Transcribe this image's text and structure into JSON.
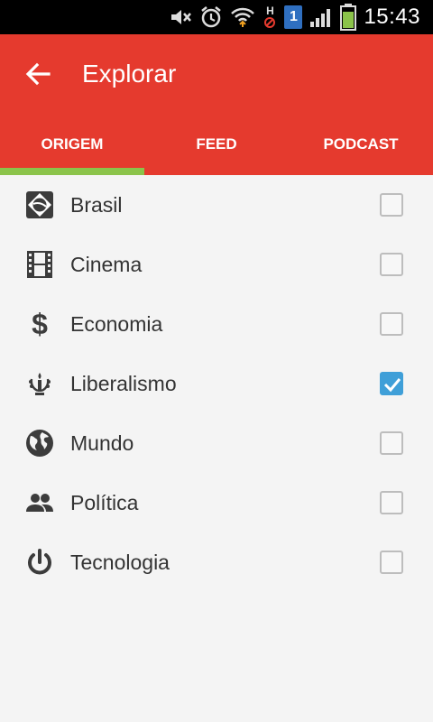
{
  "status_bar": {
    "time": "15:43",
    "sim_badge": "1",
    "network_badge": "H"
  },
  "app_bar": {
    "title": "Explorar",
    "back_label": "back"
  },
  "tabs": [
    {
      "label": "ORIGEM",
      "selected": true
    },
    {
      "label": "FEED",
      "selected": false
    },
    {
      "label": "PODCAST",
      "selected": false
    }
  ],
  "items": [
    {
      "label": "Brasil",
      "icon": "brazil-icon",
      "checked": false
    },
    {
      "label": "Cinema",
      "icon": "film-strip-icon",
      "checked": false
    },
    {
      "label": "Economia",
      "icon": "dollar-icon",
      "checked": false
    },
    {
      "label": "Liberalismo",
      "icon": "torch-laurel-icon",
      "checked": true
    },
    {
      "label": "Mundo",
      "icon": "globe-icon",
      "checked": false
    },
    {
      "label": "Política",
      "icon": "people-icon",
      "checked": false
    },
    {
      "label": "Tecnologia",
      "icon": "power-icon",
      "checked": false
    }
  ],
  "colors": {
    "primary": "#e53a2e",
    "tab_indicator": "#8bc34a",
    "checkbox_checked": "#3f9fd8",
    "battery": "#8bc34a"
  }
}
